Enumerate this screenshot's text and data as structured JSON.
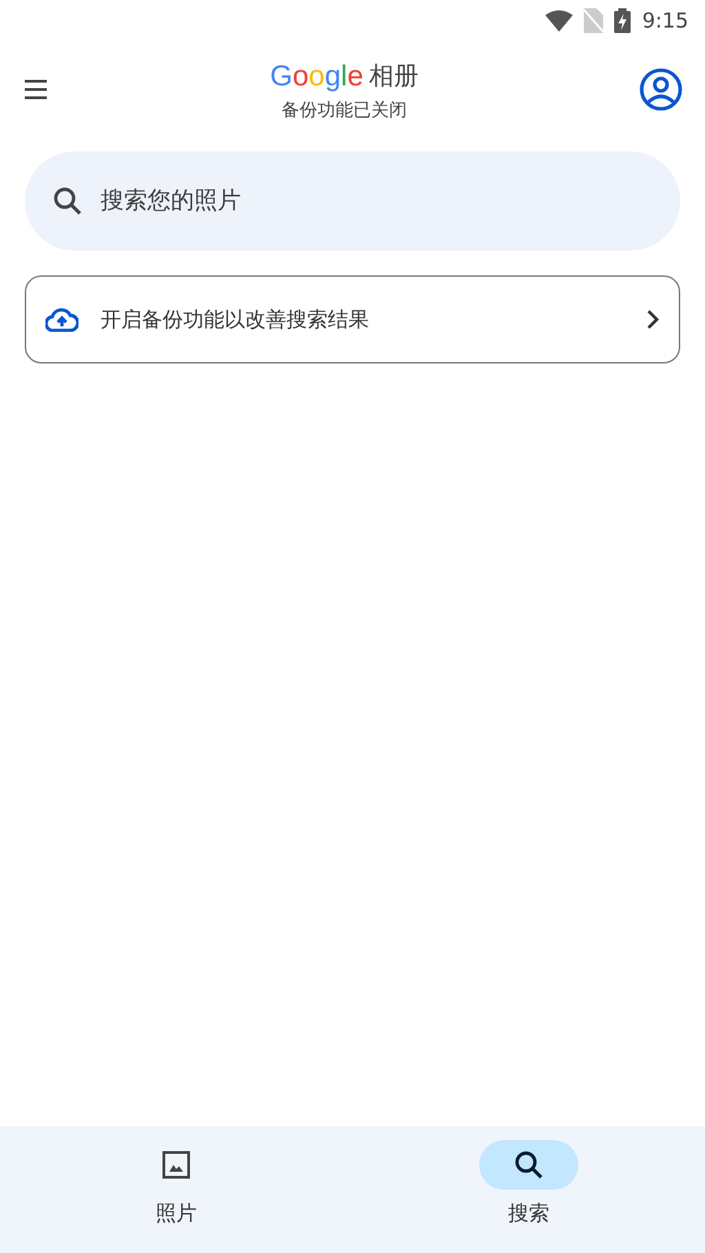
{
  "status_bar": {
    "time": "9:15"
  },
  "header": {
    "logo": "Google",
    "title": "相册",
    "subtitle": "备份功能已关闭"
  },
  "search": {
    "placeholder": "搜索您的照片"
  },
  "backup_prompt": {
    "text": "开启备份功能以改善搜索结果"
  },
  "bottom_nav": [
    {
      "label": "照片",
      "kind": "photos",
      "selected": false
    },
    {
      "label": "搜索",
      "kind": "search",
      "selected": true
    }
  ]
}
